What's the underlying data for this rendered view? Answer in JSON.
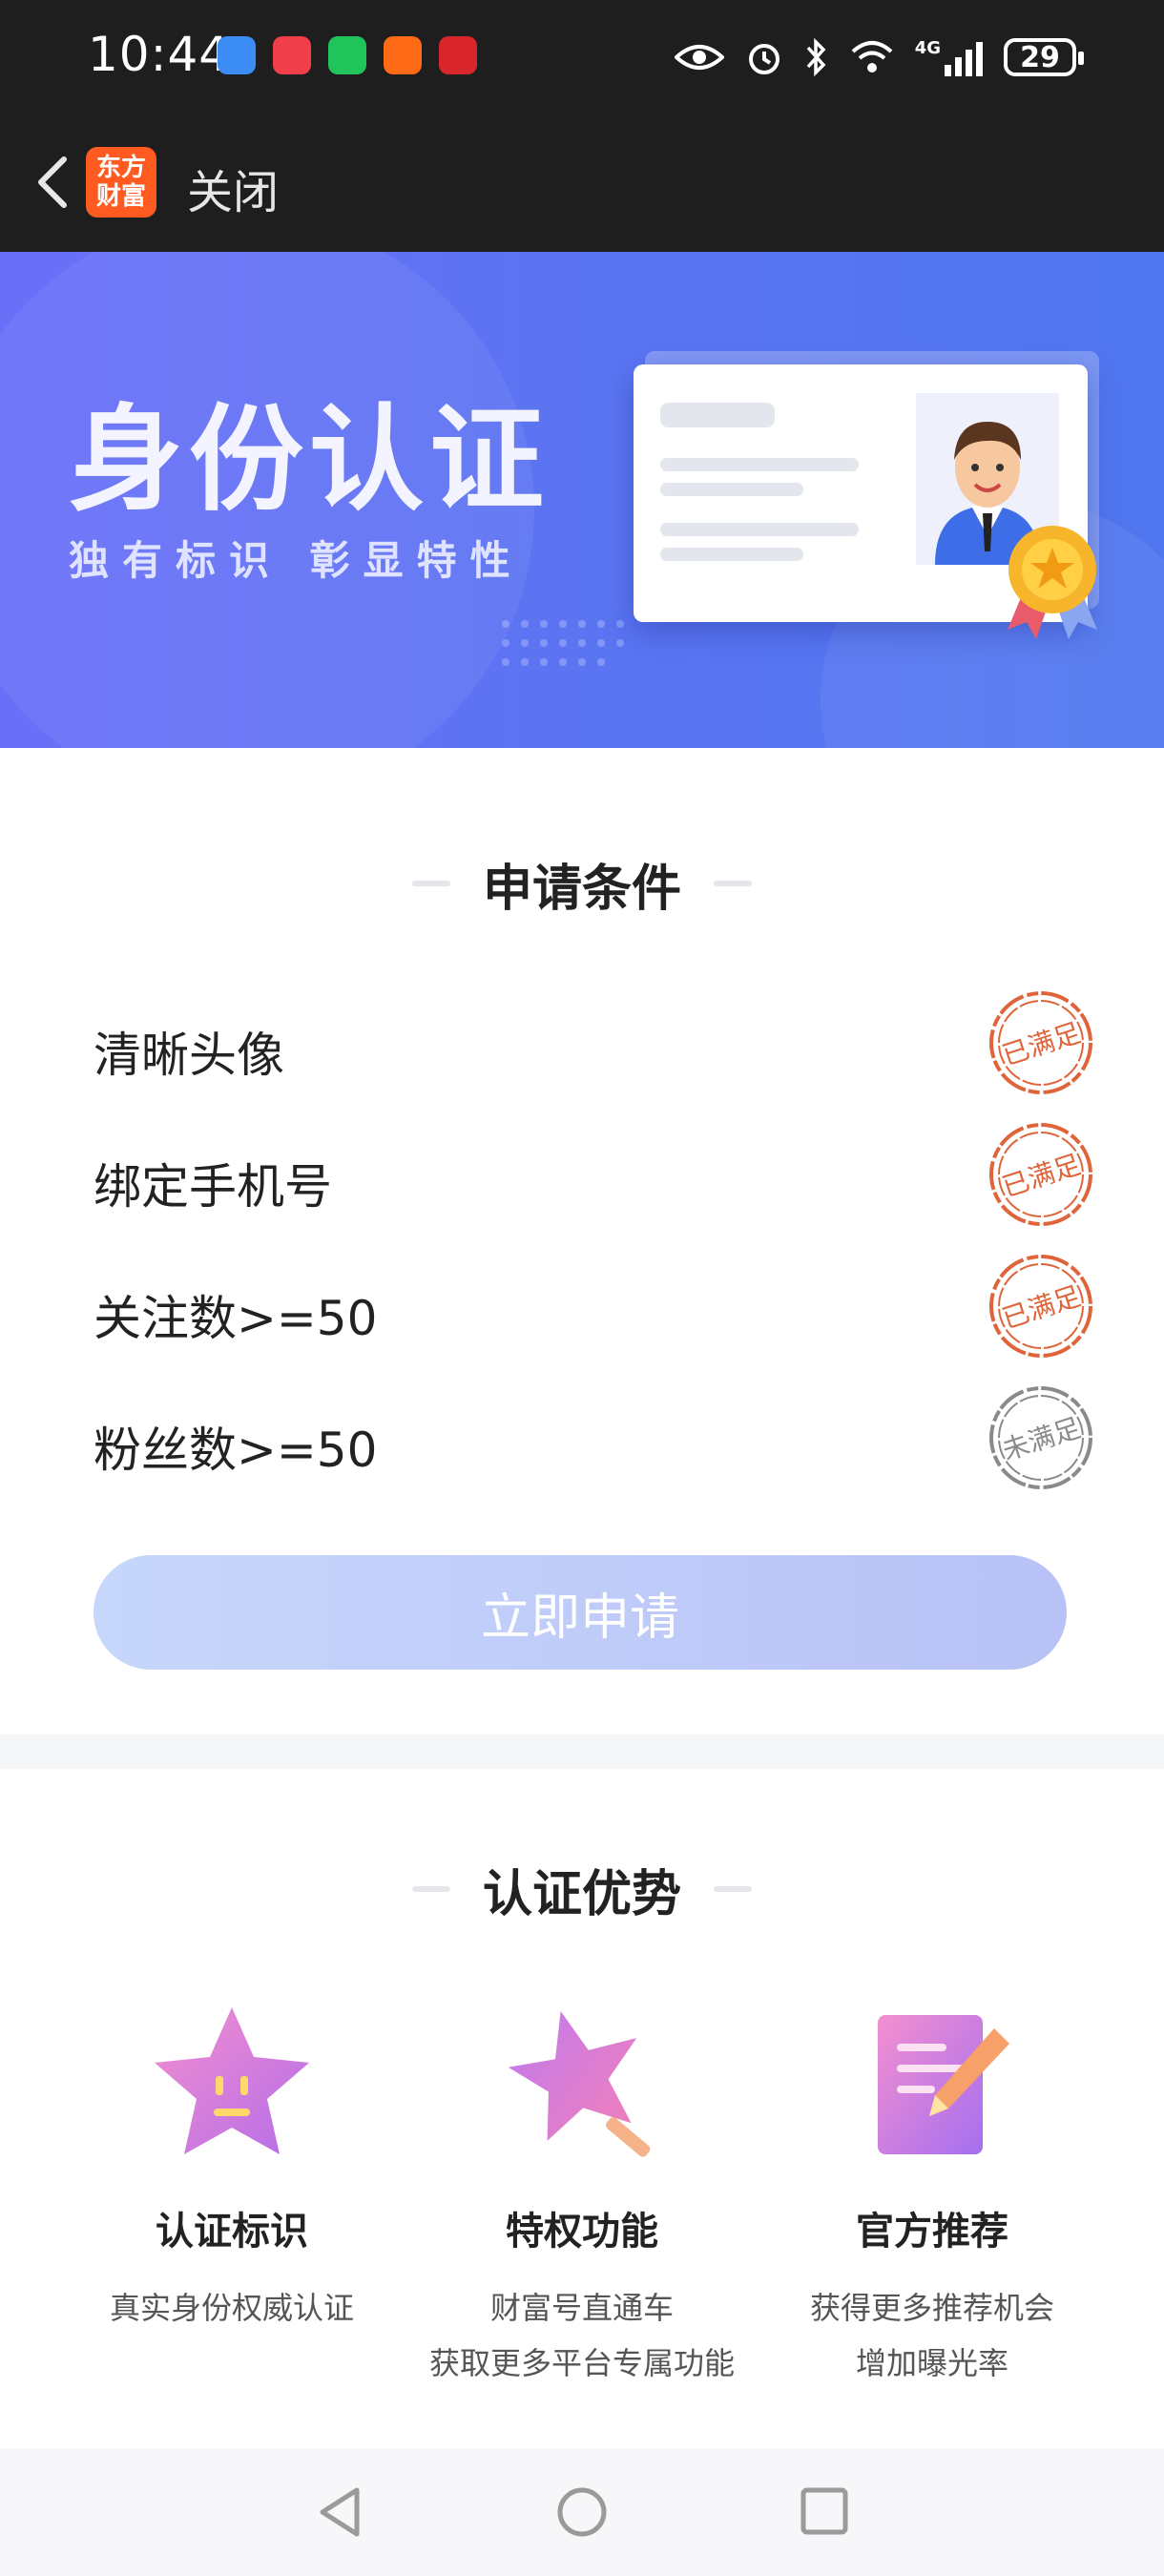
{
  "status_bar": {
    "time": "10:44",
    "battery": "29",
    "network": "4G"
  },
  "nav": {
    "logo_text": "东方财富",
    "close_label": "关闭"
  },
  "banner": {
    "title": "身份认证",
    "subtitle": "独有标识 彰显特性"
  },
  "conditions": {
    "title": "申请条件",
    "items": [
      {
        "label": "清晰头像",
        "status": "已满足"
      },
      {
        "label": "绑定手机号",
        "status": "已满足"
      },
      {
        "label": "关注数>=50",
        "status": "已满足"
      },
      {
        "label": "粉丝数>=50",
        "status": "未满足"
      }
    ],
    "apply_button": "立即申请"
  },
  "advantages": {
    "title": "认证优势",
    "items": [
      {
        "title": "认证标识",
        "desc_lines": [
          "真实身份权威认证"
        ]
      },
      {
        "title": "特权功能",
        "desc_lines": [
          "财富号直通车",
          "获取更多平台专属功能"
        ]
      },
      {
        "title": "官方推荐",
        "desc_lines": [
          "获得更多推荐机会",
          "增加曝光率"
        ]
      }
    ]
  },
  "colors": {
    "banner_start": "#6a6ff8",
    "banner_end": "#4f76ef",
    "stamp_met": "#e0643a",
    "stamp_unmet": "#8a8a8a",
    "button_start": "#c7d6fb",
    "button_end": "#b8c2f6"
  }
}
